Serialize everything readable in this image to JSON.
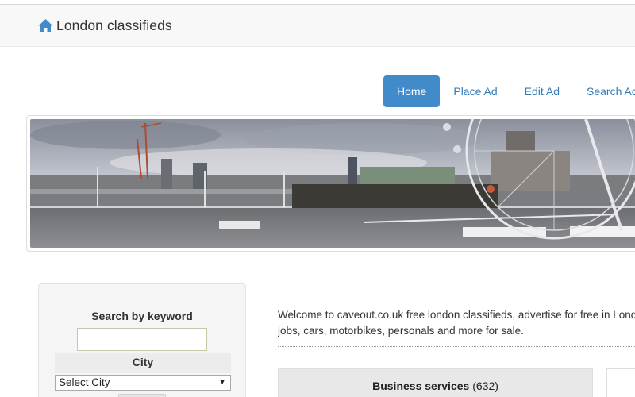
{
  "header": {
    "title": "London classifieds",
    "icon": "home-icon"
  },
  "nav": {
    "tabs": [
      {
        "label": "Home",
        "active": true
      },
      {
        "label": "Place Ad",
        "active": false
      },
      {
        "label": "Edit Ad",
        "active": false
      },
      {
        "label": "Search Ads",
        "active": false
      }
    ]
  },
  "search": {
    "keyword_label": "Search by keyword",
    "keyword_value": "",
    "city_label": "City",
    "city_selected": "Select City"
  },
  "main": {
    "welcome_line1": "Welcome to caveout.co.uk free london classifieds, advertise for free in London",
    "welcome_line2": "jobs, cars, motorbikes, personals and more for sale.",
    "categories": [
      {
        "name": "Business services",
        "count": "(632)"
      }
    ]
  },
  "colors": {
    "accent": "#428bca",
    "link": "#337ab7",
    "navbar_bg": "#f8f8f8"
  }
}
